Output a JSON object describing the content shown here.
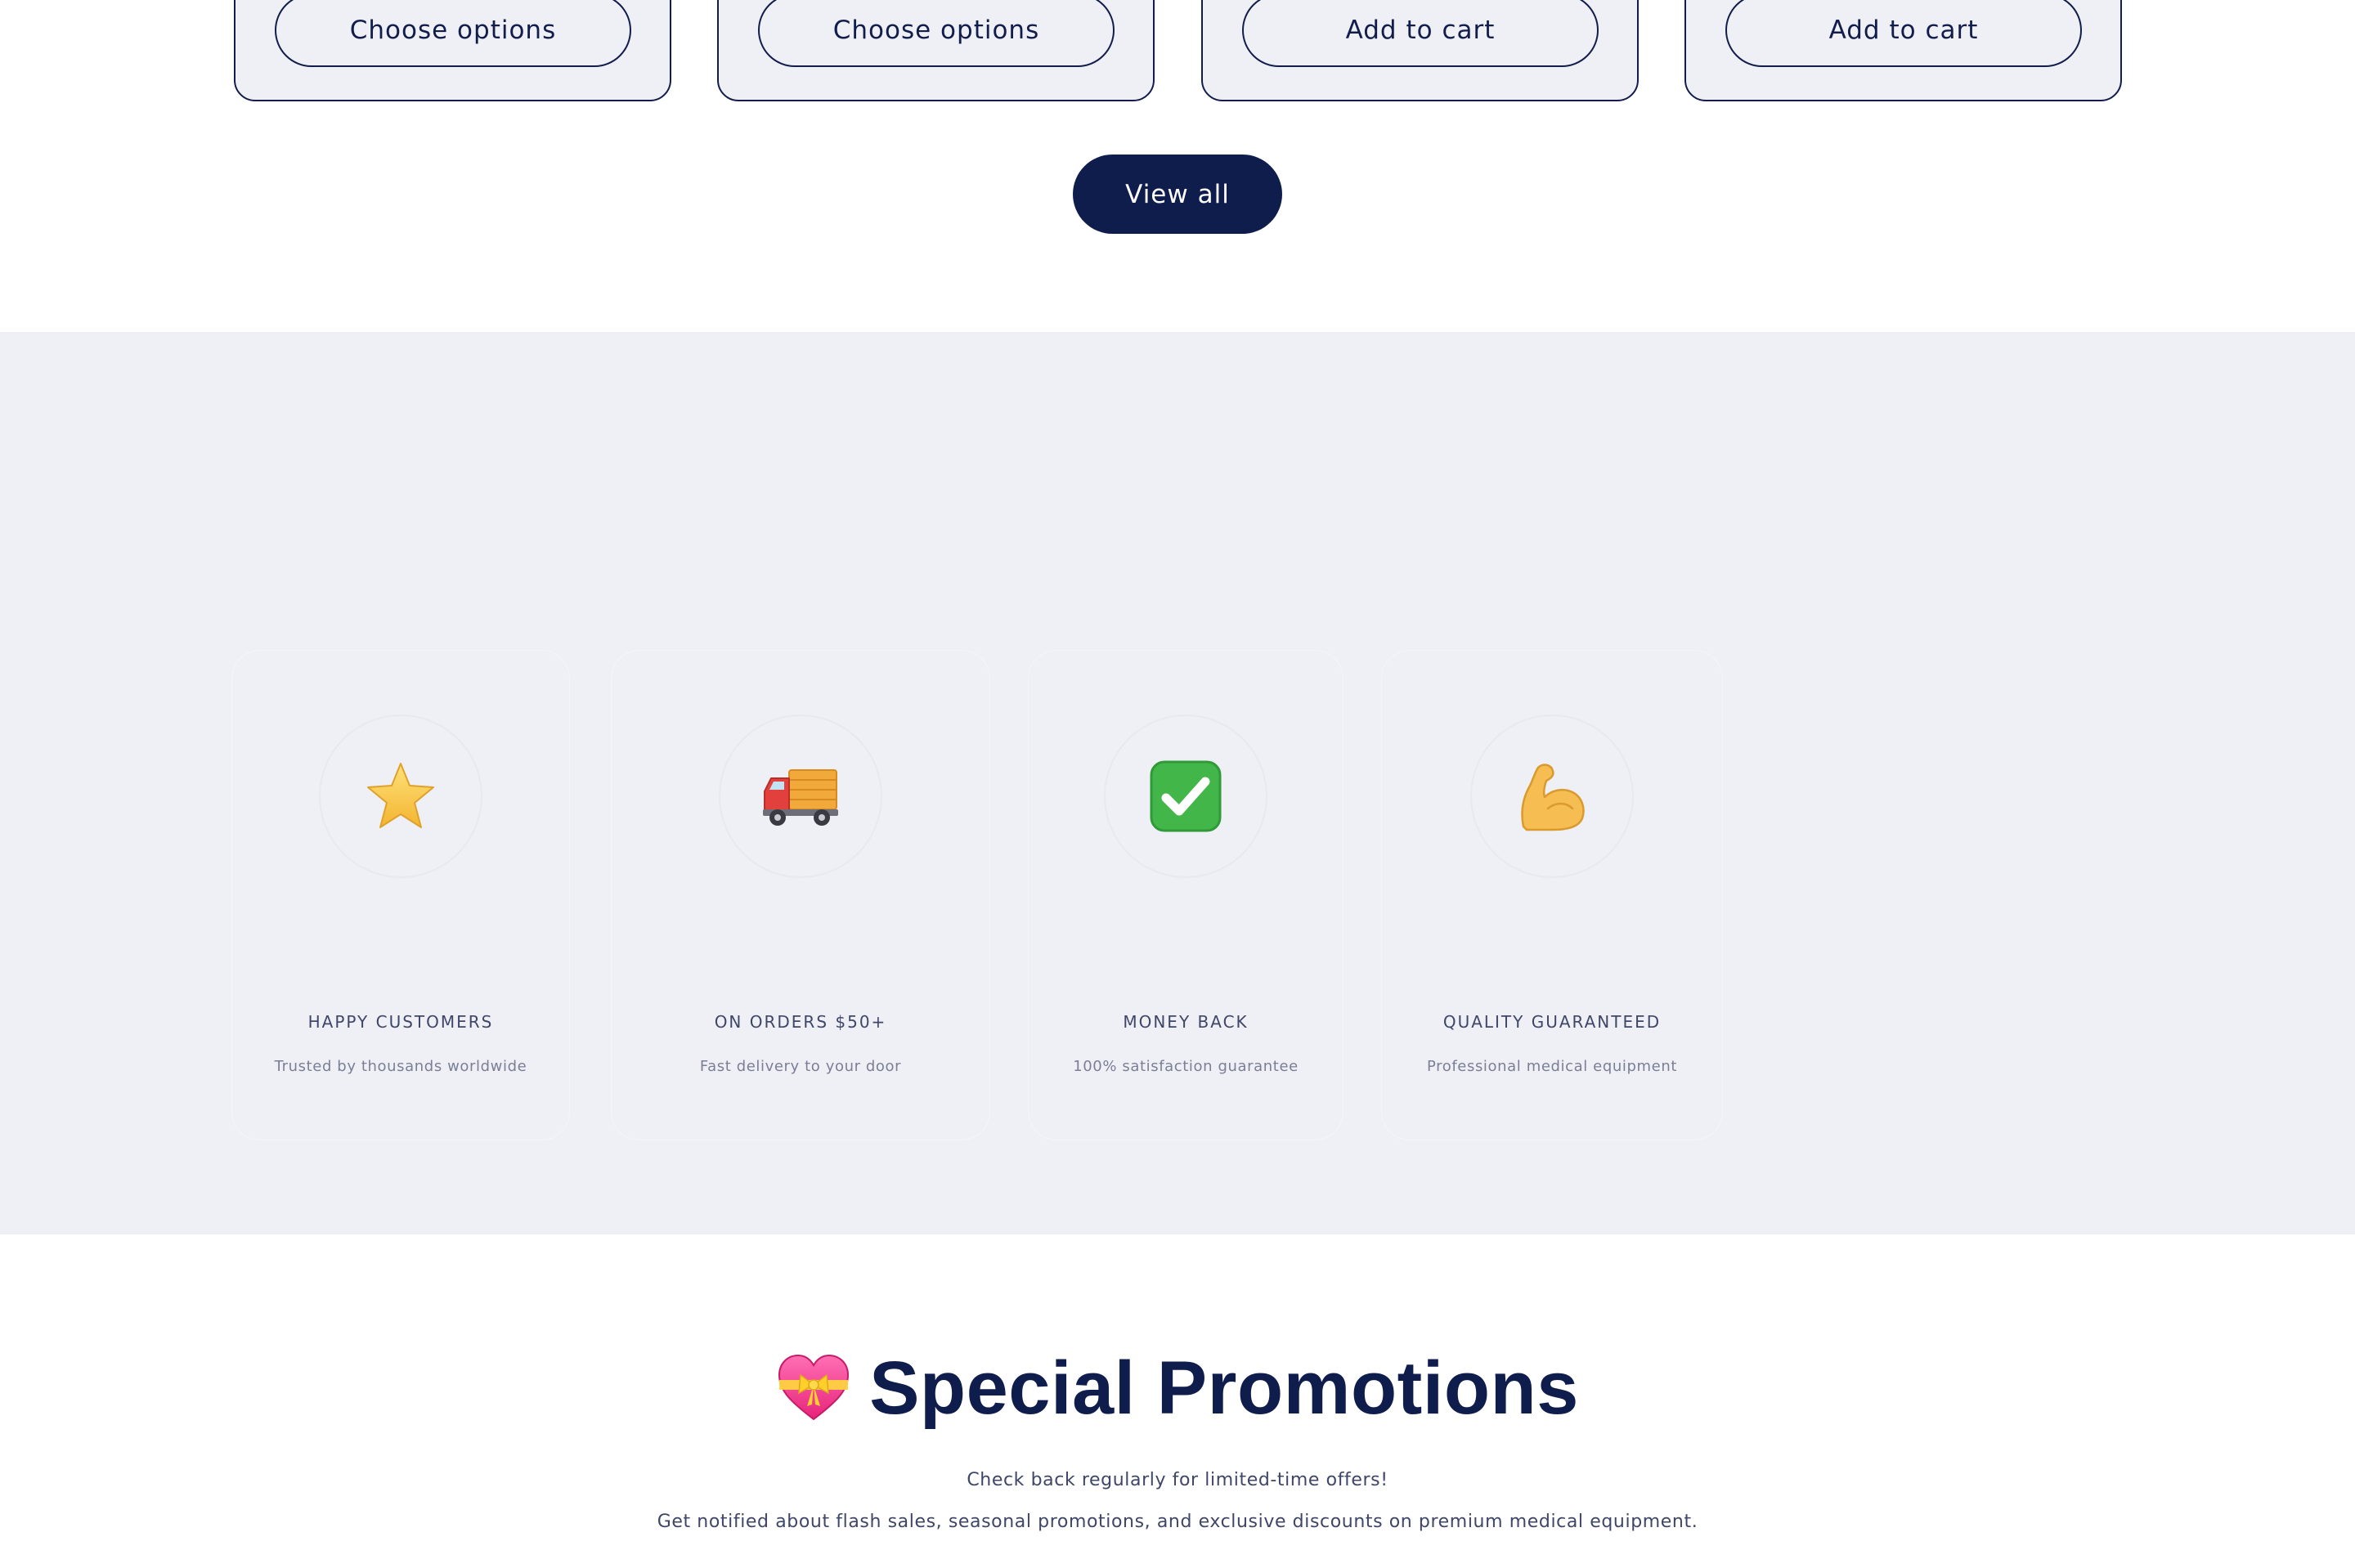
{
  "products": {
    "cards": [
      {
        "button_label": "Choose options"
      },
      {
        "button_label": "Choose options"
      },
      {
        "button_label": "Add to cart"
      },
      {
        "button_label": "Add to cart"
      }
    ],
    "view_all_label": "View all"
  },
  "features": [
    {
      "icon": "star-icon",
      "title": "HAPPY CUSTOMERS",
      "description": "Trusted by thousands worldwide"
    },
    {
      "icon": "delivery-truck-icon",
      "title": "ON ORDERS $50+",
      "description": "Fast delivery to your door"
    },
    {
      "icon": "check-mark-icon",
      "title": "MONEY BACK",
      "description": "100% satisfaction guarantee"
    },
    {
      "icon": "flexed-biceps-icon",
      "title": "QUALITY GUARANTEED",
      "description": "Professional medical equipment"
    }
  ],
  "promotions": {
    "icon": "heart-with-ribbon-icon",
    "title": "Special Promotions",
    "line_1": "Check back regularly for limited-time offers!",
    "line_2": "Get notified about flash sales, seasonal promotions, and exclusive discounts on premium medical equipment."
  },
  "colors": {
    "navy": "#0f1d4d",
    "band_background": "#eef0f6",
    "text_muted": "#7a7f96"
  }
}
